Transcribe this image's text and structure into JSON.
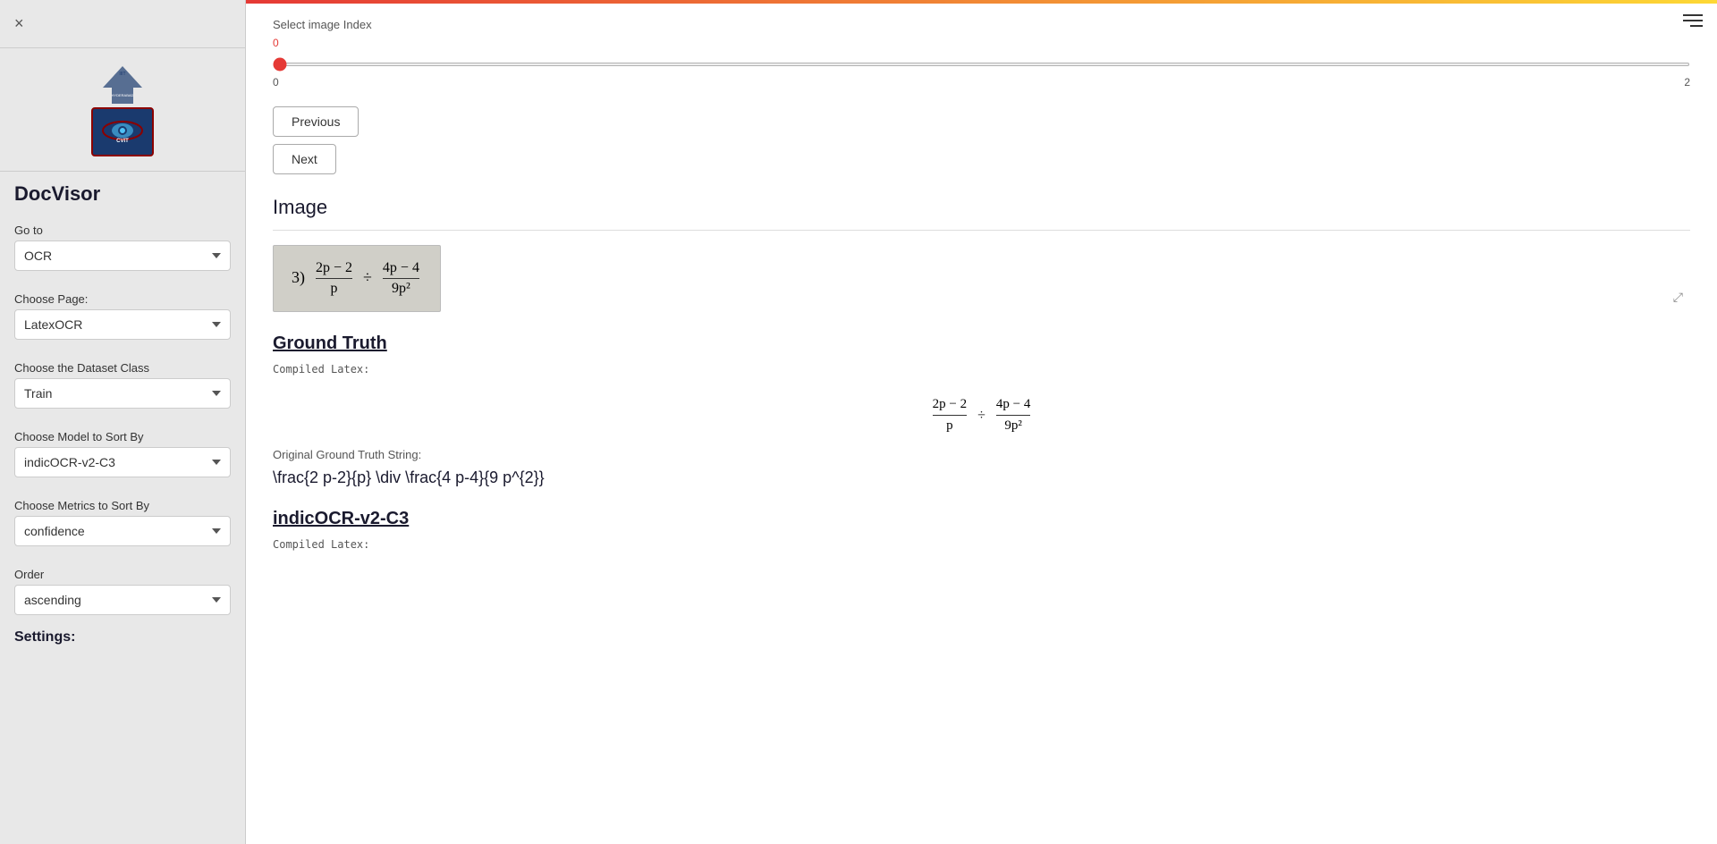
{
  "sidebar": {
    "close_label": "×",
    "app_title": "DocVisor",
    "goto_label": "Go to",
    "goto_options": [
      "OCR"
    ],
    "goto_value": "OCR",
    "choose_page_label": "Choose Page:",
    "choose_page_options": [
      "LatexOCR"
    ],
    "choose_page_value": "LatexOCR",
    "choose_dataset_label": "Choose the Dataset Class",
    "choose_dataset_options": [
      "Train"
    ],
    "choose_dataset_value": "Train",
    "choose_model_label": "Choose Model to Sort By",
    "choose_model_options": [
      "indicOCR-v2-C3"
    ],
    "choose_model_value": "indicOCR-v2-C3",
    "choose_metrics_label": "Choose Metrics to Sort By",
    "choose_metrics_options": [
      "confidence"
    ],
    "choose_metrics_value": "confidence",
    "order_label": "Order",
    "order_options": [
      "ascending"
    ],
    "order_value": "ascending",
    "settings_label": "Settings:"
  },
  "main": {
    "slider_label": "Select image Index",
    "slider_value_top": "0",
    "slider_min": "0",
    "slider_max": "2",
    "slider_current": "0",
    "prev_button": "Previous",
    "next_button": "Next",
    "image_section_title": "Image",
    "ground_truth_title": "Ground Truth",
    "compiled_latex_label": "Compiled Latex:",
    "original_gt_label": "Original Ground Truth String:",
    "original_gt_string": "\\frac{2 p-2}{p} \\div \\frac{4 p-4}{9 p^{2}}",
    "model_title": "indicOCR-v2-C3",
    "model_compiled_latex_label": "Compiled Latex:"
  },
  "topbar": {
    "menu_icon": "☰"
  }
}
